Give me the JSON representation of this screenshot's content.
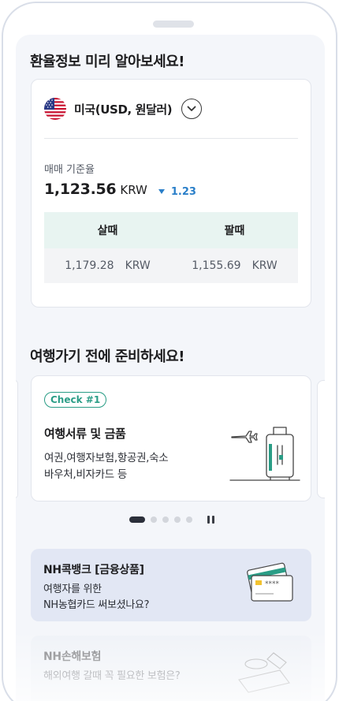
{
  "exchange": {
    "section_title": "환율정보 미리 알아보세요!",
    "country": "미국(USD, 원달러)",
    "flag_icon": "us-flag-icon",
    "base_rate_label": "매매 기준율",
    "base_rate_value": "1,123.56",
    "base_rate_unit": "KRW",
    "change_direction": "down",
    "change_value": "1.23",
    "buy_header": "살때",
    "sell_header": "팔때",
    "buy_value": "1,179.28",
    "buy_unit": "KRW",
    "sell_value": "1,155.69",
    "sell_unit": "KRW"
  },
  "travel": {
    "section_title": "여행가기 전에 준비하세요!",
    "badge": "Check #1",
    "title": "여행서류 및 금품",
    "desc_line1": "여권,여행자보험,항공권,숙소",
    "desc_line2": "바우처,비자카드 등",
    "illustration": "plane-suitcase-illustration",
    "pager": {
      "total": 5,
      "active_index": 0
    }
  },
  "promos": [
    {
      "title": "NH콕뱅크 [금융상품]",
      "desc_line1": "여행자를 위한",
      "desc_line2": "NH농협카드 써보셨나요?",
      "card_number": "****",
      "illustration": "credit-card-illustration"
    },
    {
      "title": "NH손해보험",
      "desc_line1": "해외여행 갈때 꼭 필요한 보험은?",
      "illustration": "insurance-illustration"
    }
  ],
  "colors": {
    "accent_teal": "#2a9d86",
    "change_blue": "#2a7fc9",
    "promo_bg": "#e2e7f4",
    "table_header_bg": "#e8f4f1"
  }
}
